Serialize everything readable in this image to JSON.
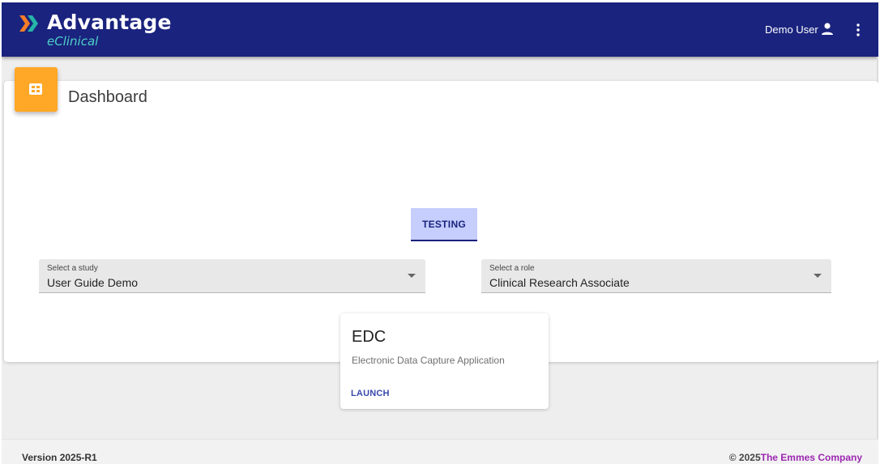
{
  "header": {
    "brand": "Advantage",
    "brand_sub": "eClinical",
    "user_name": "Demo User",
    "colors": {
      "bar": "#1a237e",
      "brand_sub": "#4dd0c8",
      "logo_orange": "#f57c28",
      "logo_teal": "#26b5a8"
    },
    "icons": {
      "logo": "chevron-logo-icon",
      "user": "person-icon",
      "menu": "more-vert-icon"
    }
  },
  "page": {
    "title": "Dashboard",
    "title_icon": "dashboard-grid-icon",
    "accent": "#ffa726"
  },
  "tabs": [
    {
      "label": "TESTING",
      "active": true
    }
  ],
  "filters": {
    "study": {
      "label": "Select a study",
      "value": "User Guide Demo"
    },
    "role": {
      "label": "Select a role",
      "value": "Clinical Research Associate"
    }
  },
  "apps": [
    {
      "title": "EDC",
      "description": "Electronic Data Capture Application",
      "action": "LAUNCH"
    }
  ],
  "footer": {
    "version": "Version 2025-R1",
    "copyright_year": "© 2025",
    "company": "The Emmes Company",
    "company_color": "#9c27b0"
  }
}
